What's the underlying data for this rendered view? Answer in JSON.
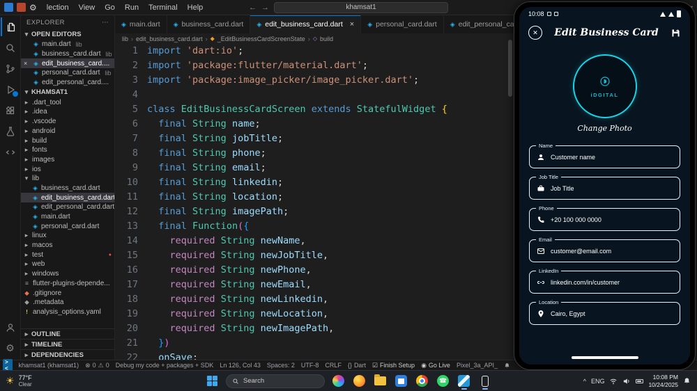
{
  "glyphs": {
    "close": "✕",
    "times": "×",
    "chevron_down": "▾",
    "chevron_right": "▸",
    "sep": "›",
    "dart_file": "◈",
    "diamond": "◆",
    "list": "≡",
    "exclaim": "!",
    "dot": "●",
    "warn": "⚠",
    "error": "⊗",
    "gear": "⚙",
    "sun": "☀",
    "phone": "☎",
    "ellipsis": "⋯",
    "back": "←",
    "forward": "→",
    "caret": "^",
    "braces": "{}",
    "broadcast": "◉",
    "check": "☑",
    "class_sym": "◆",
    "method_sym": "◇"
  },
  "titlebar": {
    "menus": [
      "lection",
      "View",
      "Go",
      "Run",
      "Terminal",
      "Help"
    ],
    "search_value": "khamsat1"
  },
  "sidebar": {
    "title": "EXPLORER",
    "open_editors_label": "OPEN EDITORS",
    "open_editors": [
      {
        "name": "main.dart",
        "suffix": "lib"
      },
      {
        "name": "business_card.dart",
        "suffix": "lib"
      },
      {
        "name": "edit_business_card....",
        "suffix": "",
        "active": true
      },
      {
        "name": "personal_card.dart",
        "suffix": "lib"
      },
      {
        "name": "edit_personal_card....",
        "suffix": ""
      }
    ],
    "project_label": "KHAMSAT1",
    "tree": [
      {
        "label": ".dart_tool",
        "type": "folder",
        "depth": 1
      },
      {
        "label": ".idea",
        "type": "folder",
        "depth": 1
      },
      {
        "label": ".vscode",
        "type": "folder",
        "depth": 1
      },
      {
        "label": "android",
        "type": "folder",
        "depth": 1
      },
      {
        "label": "build",
        "type": "folder",
        "depth": 1
      },
      {
        "label": "fonts",
        "type": "folder",
        "depth": 1
      },
      {
        "label": "images",
        "type": "folder",
        "depth": 1
      },
      {
        "label": "ios",
        "type": "folder",
        "depth": 1
      },
      {
        "label": "lib",
        "type": "folder",
        "depth": 1,
        "expanded": true
      },
      {
        "label": "business_card.dart",
        "type": "file",
        "icon": "dart",
        "depth": 2
      },
      {
        "label": "edit_business_card.dart",
        "type": "file",
        "icon": "dart",
        "depth": 2,
        "selected": true
      },
      {
        "label": "edit_personal_card.dart",
        "type": "file",
        "icon": "dart",
        "depth": 2
      },
      {
        "label": "main.dart",
        "type": "file",
        "icon": "dart",
        "depth": 2
      },
      {
        "label": "personal_card.dart",
        "type": "file",
        "icon": "dart",
        "depth": 2
      },
      {
        "label": "linux",
        "type": "folder",
        "depth": 1
      },
      {
        "label": "macos",
        "type": "folder",
        "depth": 1
      },
      {
        "label": "test",
        "type": "folder",
        "depth": 1,
        "modified": true
      },
      {
        "label": "web",
        "type": "folder",
        "depth": 1
      },
      {
        "label": "windows",
        "type": "folder",
        "depth": 1
      },
      {
        "label": "flutter-plugins-depende...",
        "type": "file",
        "icon": "list",
        "depth": 1
      },
      {
        "label": ".gitignore",
        "type": "file",
        "icon": "git",
        "depth": 1
      },
      {
        "label": ".metadata",
        "type": "file",
        "icon": "meta",
        "depth": 1
      },
      {
        "label": "analysis_options.yaml",
        "type": "file",
        "icon": "yaml",
        "depth": 1
      }
    ],
    "bottom_sections": [
      "OUTLINE",
      "TIMELINE",
      "DEPENDENCIES"
    ]
  },
  "tabs": [
    {
      "name": "main.dart"
    },
    {
      "name": "business_card.dart"
    },
    {
      "name": "edit_business_card.dart",
      "active": true
    },
    {
      "name": "personal_card.dart"
    },
    {
      "name": "edit_personal_card.dart"
    }
  ],
  "breadcrumb": [
    {
      "label": "lib"
    },
    {
      "label": "edit_business_card.dart"
    },
    {
      "label": "_EditBusinessCardScreenState",
      "icon": "cls"
    },
    {
      "label": "build",
      "icon": "mth"
    }
  ],
  "code": {
    "lines": [
      [
        [
          "import",
          "k"
        ],
        [
          " ",
          "p"
        ],
        [
          "'dart:io'",
          "s"
        ],
        [
          ";",
          "p"
        ]
      ],
      [
        [
          "import",
          "k"
        ],
        [
          " ",
          "p"
        ],
        [
          "'package:flutter/material.dart'",
          "s"
        ],
        [
          ";",
          "p"
        ]
      ],
      [
        [
          "import",
          "k"
        ],
        [
          " ",
          "p"
        ],
        [
          "'package:image_picker/image_picker.dart'",
          "s"
        ],
        [
          ";",
          "p"
        ]
      ],
      [],
      [
        [
          "class",
          "k"
        ],
        [
          " ",
          "p"
        ],
        [
          "EditBusinessCardScreen",
          "t"
        ],
        [
          " ",
          "p"
        ],
        [
          "extends",
          "k"
        ],
        [
          " ",
          "p"
        ],
        [
          "StatefulWidget",
          "t"
        ],
        [
          " ",
          "p"
        ],
        [
          "{",
          "b1"
        ]
      ],
      [
        [
          "  ",
          "p"
        ],
        [
          "final",
          "k"
        ],
        [
          " ",
          "p"
        ],
        [
          "String",
          "t"
        ],
        [
          " ",
          "p"
        ],
        [
          "name",
          "v"
        ],
        [
          ";",
          "p"
        ]
      ],
      [
        [
          "  ",
          "p"
        ],
        [
          "final",
          "k"
        ],
        [
          " ",
          "p"
        ],
        [
          "String",
          "t"
        ],
        [
          " ",
          "p"
        ],
        [
          "jobTitle",
          "v"
        ],
        [
          ";",
          "p"
        ]
      ],
      [
        [
          "  ",
          "p"
        ],
        [
          "final",
          "k"
        ],
        [
          " ",
          "p"
        ],
        [
          "String",
          "t"
        ],
        [
          " ",
          "p"
        ],
        [
          "phone",
          "v"
        ],
        [
          ";",
          "p"
        ]
      ],
      [
        [
          "  ",
          "p"
        ],
        [
          "final",
          "k"
        ],
        [
          " ",
          "p"
        ],
        [
          "String",
          "t"
        ],
        [
          " ",
          "p"
        ],
        [
          "email",
          "v"
        ],
        [
          ";",
          "p"
        ]
      ],
      [
        [
          "  ",
          "p"
        ],
        [
          "final",
          "k"
        ],
        [
          " ",
          "p"
        ],
        [
          "String",
          "t"
        ],
        [
          " ",
          "p"
        ],
        [
          "linkedin",
          "v"
        ],
        [
          ";",
          "p"
        ]
      ],
      [
        [
          "  ",
          "p"
        ],
        [
          "final",
          "k"
        ],
        [
          " ",
          "p"
        ],
        [
          "String",
          "t"
        ],
        [
          " ",
          "p"
        ],
        [
          "location",
          "v"
        ],
        [
          ";",
          "p"
        ]
      ],
      [
        [
          "  ",
          "p"
        ],
        [
          "final",
          "k"
        ],
        [
          " ",
          "p"
        ],
        [
          "String",
          "t"
        ],
        [
          " ",
          "p"
        ],
        [
          "imagePath",
          "v"
        ],
        [
          ";",
          "p"
        ]
      ],
      [
        [
          "  ",
          "p"
        ],
        [
          "final",
          "k"
        ],
        [
          " ",
          "p"
        ],
        [
          "Function",
          "t"
        ],
        [
          "(",
          "b2"
        ],
        [
          "{",
          "b3"
        ]
      ],
      [
        [
          "    ",
          "p"
        ],
        [
          "required",
          "r"
        ],
        [
          " ",
          "p"
        ],
        [
          "String",
          "t"
        ],
        [
          " ",
          "p"
        ],
        [
          "newName",
          "v"
        ],
        [
          ",",
          "p"
        ]
      ],
      [
        [
          "    ",
          "p"
        ],
        [
          "required",
          "r"
        ],
        [
          " ",
          "p"
        ],
        [
          "String",
          "t"
        ],
        [
          " ",
          "p"
        ],
        [
          "newJobTitle",
          "v"
        ],
        [
          ",",
          "p"
        ]
      ],
      [
        [
          "    ",
          "p"
        ],
        [
          "required",
          "r"
        ],
        [
          " ",
          "p"
        ],
        [
          "String",
          "t"
        ],
        [
          " ",
          "p"
        ],
        [
          "newPhone",
          "v"
        ],
        [
          ",",
          "p"
        ]
      ],
      [
        [
          "    ",
          "p"
        ],
        [
          "required",
          "r"
        ],
        [
          " ",
          "p"
        ],
        [
          "String",
          "t"
        ],
        [
          " ",
          "p"
        ],
        [
          "newEmail",
          "v"
        ],
        [
          ",",
          "p"
        ]
      ],
      [
        [
          "    ",
          "p"
        ],
        [
          "required",
          "r"
        ],
        [
          " ",
          "p"
        ],
        [
          "String",
          "t"
        ],
        [
          " ",
          "p"
        ],
        [
          "newLinkedin",
          "v"
        ],
        [
          ",",
          "p"
        ]
      ],
      [
        [
          "    ",
          "p"
        ],
        [
          "required",
          "r"
        ],
        [
          " ",
          "p"
        ],
        [
          "String",
          "t"
        ],
        [
          " ",
          "p"
        ],
        [
          "newLocation",
          "v"
        ],
        [
          ",",
          "p"
        ]
      ],
      [
        [
          "    ",
          "p"
        ],
        [
          "required",
          "r"
        ],
        [
          " ",
          "p"
        ],
        [
          "String",
          "t"
        ],
        [
          " ",
          "p"
        ],
        [
          "newImagePath",
          "v"
        ],
        [
          ",",
          "p"
        ]
      ],
      [
        [
          "  ",
          "p"
        ],
        [
          "}",
          "b3"
        ],
        [
          ")",
          "b2"
        ]
      ],
      [
        [
          "  ",
          "p"
        ],
        [
          "onSave",
          "v"
        ],
        [
          ";",
          "p"
        ]
      ]
    ]
  },
  "status_bar": {
    "remote_glyph": "><",
    "remote": "khamsat1 (khamsat1)",
    "errors": "0",
    "warnings": "0",
    "message": "Debug my code + packages + SDK",
    "line_col": "Ln 126, Col 43",
    "spaces": "Spaces: 2",
    "encoding": "UTF-8",
    "eol": "CRLF",
    "language": "Dart",
    "finish_setup": "Finish Setup",
    "go_live": "Go Live",
    "device": "Pixel_3a_API_"
  },
  "emulator": {
    "status_time": "10:08",
    "title": "Edit Business Card",
    "logo_text": "iDGITAL",
    "change_photo": "Change Photo",
    "accent": "#16d5e8",
    "fields": [
      {
        "label": "Name",
        "value": "Customer name",
        "icon": "person-icon"
      },
      {
        "label": "Job Title",
        "value": "Job Title",
        "icon": "briefcase-icon"
      },
      {
        "label": "Phone",
        "value": "+20 100 000 0000",
        "icon": "phone-icon"
      },
      {
        "label": "Email",
        "value": "customer@email.com",
        "icon": "email-icon"
      },
      {
        "label": "LinkedIn",
        "value": "linkedin.com/in/customer",
        "icon": "link-icon"
      },
      {
        "label": "Location",
        "value": "Cairo, Egypt",
        "icon": "location-icon"
      }
    ]
  },
  "taskbar": {
    "weather_temp": "77°F",
    "weather_desc": "Clear",
    "search_placeholder": "Search",
    "apps": [
      "copilot",
      "firefox",
      "explorer",
      "store",
      "chrome",
      "whatsapp",
      "vscode",
      "phone"
    ],
    "tray_lang": "ENG",
    "tray_time": "10:08 PM",
    "tray_date": "10/24/2025"
  }
}
